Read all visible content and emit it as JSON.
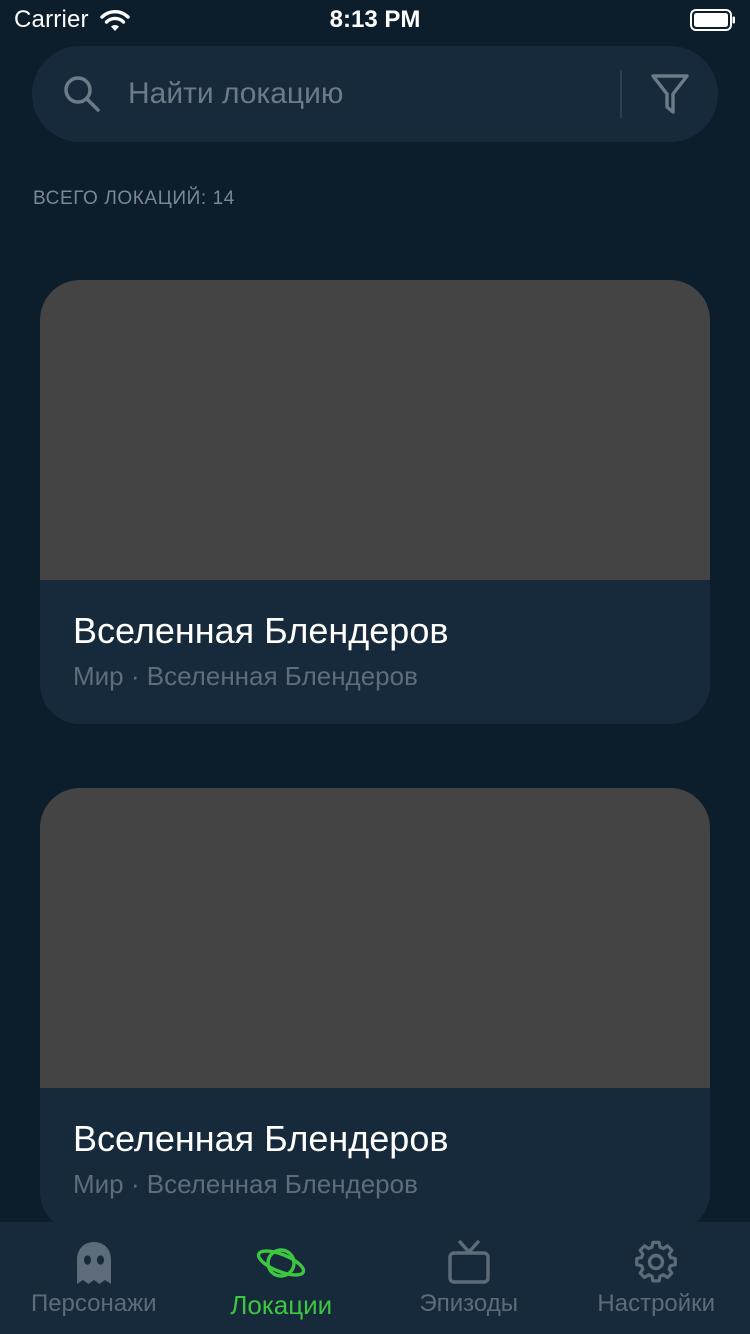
{
  "status_bar": {
    "carrier": "Carrier",
    "time": "8:13 PM"
  },
  "search": {
    "placeholder": "Найти локацию",
    "value": ""
  },
  "summary": {
    "count_label": "ВСЕГО ЛОКАЦИЙ: 14"
  },
  "locations": [
    {
      "title": "Вселенная Блендеров",
      "subtitle": "Мир · Вселенная Блендеров"
    },
    {
      "title": "Вселенная Блендеров",
      "subtitle": "Мир · Вселенная Блендеров"
    }
  ],
  "tabbar": {
    "items": [
      {
        "label": "Персонажи",
        "icon": "ghost-icon",
        "active": false
      },
      {
        "label": "Локации",
        "icon": "planet-icon",
        "active": true
      },
      {
        "label": "Эпизоды",
        "icon": "tv-icon",
        "active": false
      },
      {
        "label": "Настройки",
        "icon": "gear-icon",
        "active": false
      }
    ]
  },
  "colors": {
    "background": "#0c1e2c",
    "surface": "#172a3c",
    "accent": "#3dc63f",
    "inactive": "#5e6c79",
    "placeholder_image": "#444444"
  }
}
